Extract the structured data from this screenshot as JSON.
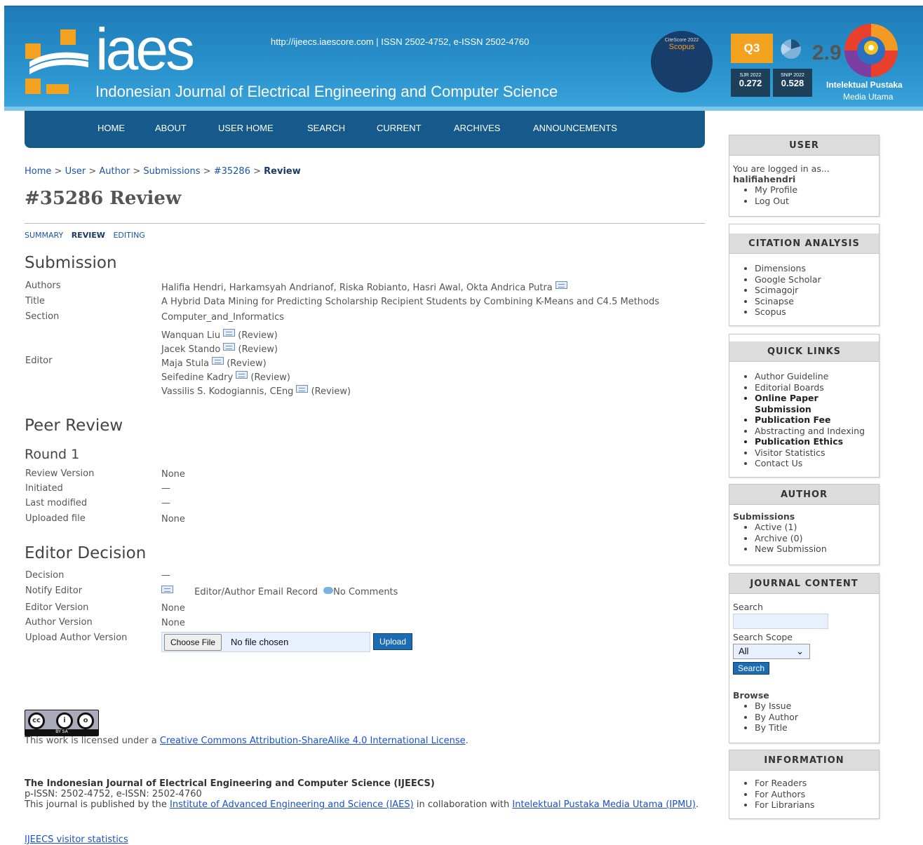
{
  "header": {
    "logo_text": "iaes",
    "url_line": "http://ijeecs.iaescore.com  |  ISSN 2502-4752, e-ISSN 2502-4760",
    "journal_name": "Indonesian Journal of Electrical Engineering and Computer Science",
    "citescore_label": "CiteScore 2022",
    "citescore_value": "2.9",
    "citescore_source": "Scopus",
    "quartile": "Q3",
    "sjr_label": "SJR 2022",
    "sjr_value": "0.272",
    "snip_label": "SNIP 2022",
    "snip_value": "0.528",
    "publisher_name": "Intelektual Pustaka",
    "publisher_sub": "Media Utama"
  },
  "nav": [
    "HOME",
    "ABOUT",
    "USER HOME",
    "SEARCH",
    "CURRENT",
    "ARCHIVES",
    "ANNOUNCEMENTS"
  ],
  "breadcrumb": {
    "items": [
      "Home",
      "User",
      "Author",
      "Submissions",
      "#35286"
    ],
    "current": "Review",
    "separator": ">"
  },
  "page_title": "#35286 Review",
  "subtabs": [
    "SUMMARY",
    "REVIEW",
    "EDITING"
  ],
  "submission": {
    "heading": "Submission",
    "authors_label": "Authors",
    "authors": "Halifia Hendri, Harkamsyah Andrianof, Riska Robianto, Hasri Awal, Okta Andrica Putra",
    "title_label": "Title",
    "title": "A Hybrid Data Mining for Predicting Scholarship Recipient Students by Combining K-Means and C4.5 Methods",
    "section_label": "Section",
    "section": "Computer_and_Informatics",
    "editor_label": "Editor",
    "editors": [
      "Wanquan Liu",
      "Jacek Stando",
      "Maja Stula",
      "Seifedine Kadry",
      "Vassilis S. Kodogiannis, CEng"
    ],
    "review_tag": "(Review)"
  },
  "peer_review": {
    "heading": "Peer Review",
    "round": "Round 1",
    "review_version_label": "Review Version",
    "review_version": "None",
    "initiated_label": "Initiated",
    "initiated": "—",
    "last_modified_label": "Last modified",
    "last_modified": "—",
    "uploaded_file_label": "Uploaded file",
    "uploaded_file": "None"
  },
  "editor_decision": {
    "heading": "Editor Decision",
    "decision_label": "Decision",
    "decision": "—",
    "notify_label": "Notify Editor",
    "email_record": "Editor/Author Email Record",
    "comments": "No Comments",
    "editor_version_label": "Editor Version",
    "editor_version": "None",
    "author_version_label": "Author Version",
    "author_version": "None",
    "upload_label": "Upload Author Version",
    "choose_file": "Choose File",
    "no_file": "No file chosen",
    "upload_button": "Upload"
  },
  "footer": {
    "cc_strip": "BY    SA",
    "license_prefix": "This work is licensed under a ",
    "license_link": "Creative Commons Attribution-ShareAlike 4.0 International License",
    "license_suffix": ".",
    "journal_title": "The Indonesian Journal of Electrical Engineering and Computer Science (IJEECS)",
    "issn": "p-ISSN: 2502-4752, e-ISSN: 2502-4760",
    "published_prefix": "This journal is published by the ",
    "iaes_link": "Institute of Advanced Engineering and Science (IAES)",
    "collab": " in collaboration with ",
    "ipmu_link": "Intelektual Pustaka Media Utama (IPMU)",
    "published_suffix": ".",
    "visitor_stats": "IJEECS visitor statistics"
  },
  "sidebar": {
    "user": {
      "title": "USER",
      "logged_in": "You are logged in as...",
      "username": "halifiahendri",
      "links": [
        "My Profile",
        "Log Out"
      ]
    },
    "citation": {
      "title": "CITATION ANALYSIS",
      "links": [
        "Dimensions",
        "Google Scholar",
        "Scimagojr",
        "Scinapse",
        "Scopus"
      ]
    },
    "quick_links": {
      "title": "QUICK LINKS",
      "links": [
        {
          "label": "Author Guideline",
          "bold": false
        },
        {
          "label": "Editorial Boards",
          "bold": false
        },
        {
          "label": "Online Paper Submission",
          "bold": true
        },
        {
          "label": "Publication Fee",
          "bold": true
        },
        {
          "label": "Abstracting and Indexing",
          "bold": false
        },
        {
          "label": "Publication Ethics",
          "bold": true
        },
        {
          "label": "Visitor Statistics",
          "bold": false
        },
        {
          "label": "Contact Us",
          "bold": false
        }
      ]
    },
    "author": {
      "title": "AUTHOR",
      "submissions_label": "Submissions",
      "links": [
        "Active (1)",
        "Archive (0)",
        "New Submission"
      ]
    },
    "journal_content": {
      "title": "JOURNAL CONTENT",
      "search_label": "Search",
      "scope_label": "Search Scope",
      "scope_value": "All",
      "search_button": "Search",
      "browse_label": "Browse",
      "browse_links": [
        "By Issue",
        "By Author",
        "By Title"
      ]
    },
    "information": {
      "title": "INFORMATION",
      "links": [
        "For Readers",
        "For Authors",
        "For Librarians"
      ]
    }
  }
}
